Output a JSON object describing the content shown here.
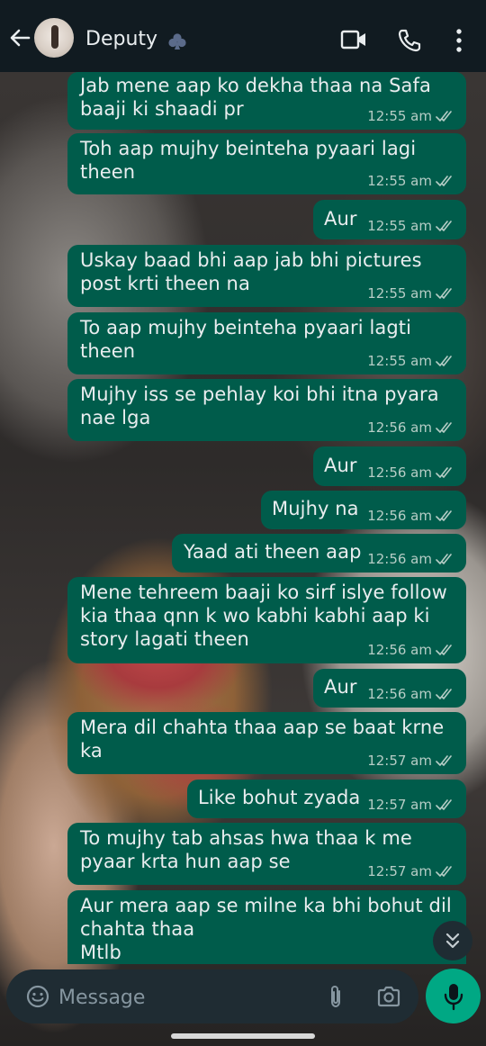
{
  "header": {
    "contact_name": "Deputy",
    "icons": {
      "back": "arrow-left-icon",
      "avatar": "contact-avatar",
      "name_emoji": "club-suit-icon",
      "video": "video-call-icon",
      "call": "phone-icon",
      "menu": "more-vertical-icon"
    }
  },
  "messages": [
    {
      "text": "Jab mene aap ko dekha thaa na Safa\nbaaji ki shaadi pr",
      "time": "12:55 am",
      "status": "read"
    },
    {
      "text": "Toh aap mujhy beinteha pyaari lagi\ntheen",
      "time": "12:55 am",
      "status": "read"
    },
    {
      "text": "Aur",
      "time": "12:55 am",
      "status": "read"
    },
    {
      "text": "Uskay baad bhi aap jab bhi pictures\npost krti theen na",
      "time": "12:55 am",
      "status": "read"
    },
    {
      "text": "To aap mujhy beinteha pyaari lagti\ntheen",
      "time": "12:55 am",
      "status": "read"
    },
    {
      "text": "Mujhy iss se pehlay koi bhi itna pyara\nnae lga",
      "time": "12:56 am",
      "status": "read"
    },
    {
      "text": "Aur",
      "time": "12:56 am",
      "status": "read"
    },
    {
      "text": "Mujhy na",
      "time": "12:56 am",
      "status": "read"
    },
    {
      "text": "Yaad ati theen aap",
      "time": "12:56 am",
      "status": "read"
    },
    {
      "text": "Mene tehreem baaji ko sirf islye follow\nkia thaa qnn k wo kabhi kabhi aap ki\nstory lagati theen",
      "time": "12:56 am",
      "status": "read"
    },
    {
      "text": "Aur",
      "time": "12:56 am",
      "status": "read"
    },
    {
      "text": "Mera dil chahta thaa aap se baat krne\nka",
      "time": "12:57 am",
      "status": "read"
    },
    {
      "text": "Like bohut zyada",
      "time": "12:57 am",
      "status": "read"
    },
    {
      "text": "To mujhy tab ahsas hwa thaa k me\npyaar krta hun aap se",
      "time": "12:57 am",
      "status": "read"
    },
    {
      "text": "Aur mera aap se milne ka bhi bohut dil\nchahta thaa\nMtlb",
      "time": "",
      "status": ""
    }
  ],
  "composer": {
    "placeholder": "Message",
    "icons": {
      "emoji": "emoji-icon",
      "attach": "paperclip-icon",
      "camera": "camera-icon",
      "mic": "microphone-icon",
      "scroll": "double-chevron-down-icon"
    }
  },
  "colors": {
    "header_bg": "#111b21",
    "outgoing_bubble": "#005c4b",
    "input_bg": "#1f2c33",
    "accent": "#00a884",
    "text": "#e9edef"
  }
}
